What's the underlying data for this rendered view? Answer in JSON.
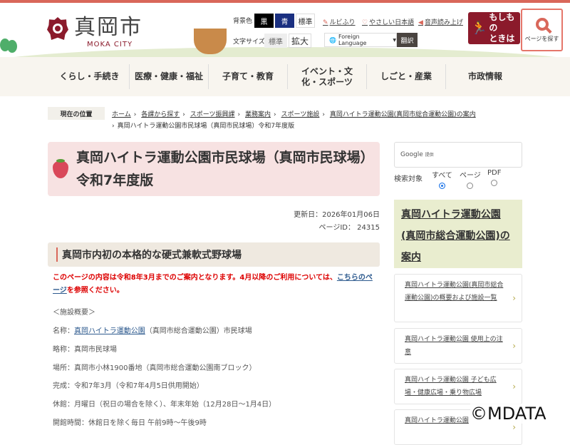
{
  "header": {
    "logo_text": "真岡市",
    "logo_sub": "MOKA CITY",
    "bg_label": "背景色",
    "bg_black": "黒",
    "bg_blue": "青",
    "bg_std": "標準",
    "size_label": "文字サイズ",
    "size_std": "標準",
    "size_large": "拡大",
    "ruby": "ルビふり",
    "easy_jp": "やさしい日本語",
    "speech": "音声読み上げ",
    "foreign": "Foreign Language",
    "translate": "翻訳",
    "emergency_l1": "もしもの",
    "emergency_l2": "ときは",
    "page_search": "ページを探す"
  },
  "nav": [
    "くらし・手続き",
    "医療・健康・福祉",
    "子育て・教育",
    "イベント・文化・スポーツ",
    "しごと・産業",
    "市政情報"
  ],
  "breadcrumb": {
    "label": "現在の位置",
    "items": [
      "ホーム",
      "各課から探す",
      "スポーツ振興課",
      "業務案内",
      "スポーツ施設",
      "真岡ハイトラ運動公園(真岡市総合運動公園)の案内"
    ],
    "current": "真岡ハイトラ運動公園市民球場（真岡市民球場）令和7年度版"
  },
  "main": {
    "title": "真岡ハイトラ運動公園市民球場（真岡市民球場）令和7年度版",
    "updated": "更新日：2026年01月06日",
    "page_id": "ページID： 24315",
    "h2": "真岡市内初の本格的な硬式兼軟式野球場",
    "notice_pre": "このページの内容は令和8年3月までのご案内となります。4月以降のご利用については、",
    "notice_link": "こちらのページ",
    "notice_post": "を参照ください。",
    "overview": "＜施設概要＞",
    "name_label": "名称：",
    "name_link": "真岡ハイトラ運動公園",
    "name_rest": "（真岡市総合運動公園）市民球場",
    "lines": [
      "略称：真岡市民球場",
      "場所：真岡市小林1900番地（真岡市総合運動公園南ブロック）",
      "完成：令和7年3月（令和7年4月5日供用開始）",
      "休館：月曜日（祝日の場合を除く）、年末年始（12月28日～1月4日）",
      "開館時間：休館日を除く毎日 午前9時～午後9時"
    ]
  },
  "sidebar": {
    "google": "Google",
    "provided": "提供",
    "search_target": "検索対象",
    "options": [
      "すべて",
      "ページ",
      "PDF"
    ],
    "selected": 0,
    "heading": "真岡ハイトラ運動公園(真岡市総合運動公園)の案内",
    "links": [
      "真岡ハイトラ運動公園(真岡市総合運動公園)の概要および施設一覧",
      "真岡ハイトラ運動公園 使用上の注意",
      "真岡ハイトラ運動公園 子ども広場・健康広場・乗り物広場",
      "真岡ハイトラ運動公園"
    ]
  },
  "watermark": "©MDATA"
}
